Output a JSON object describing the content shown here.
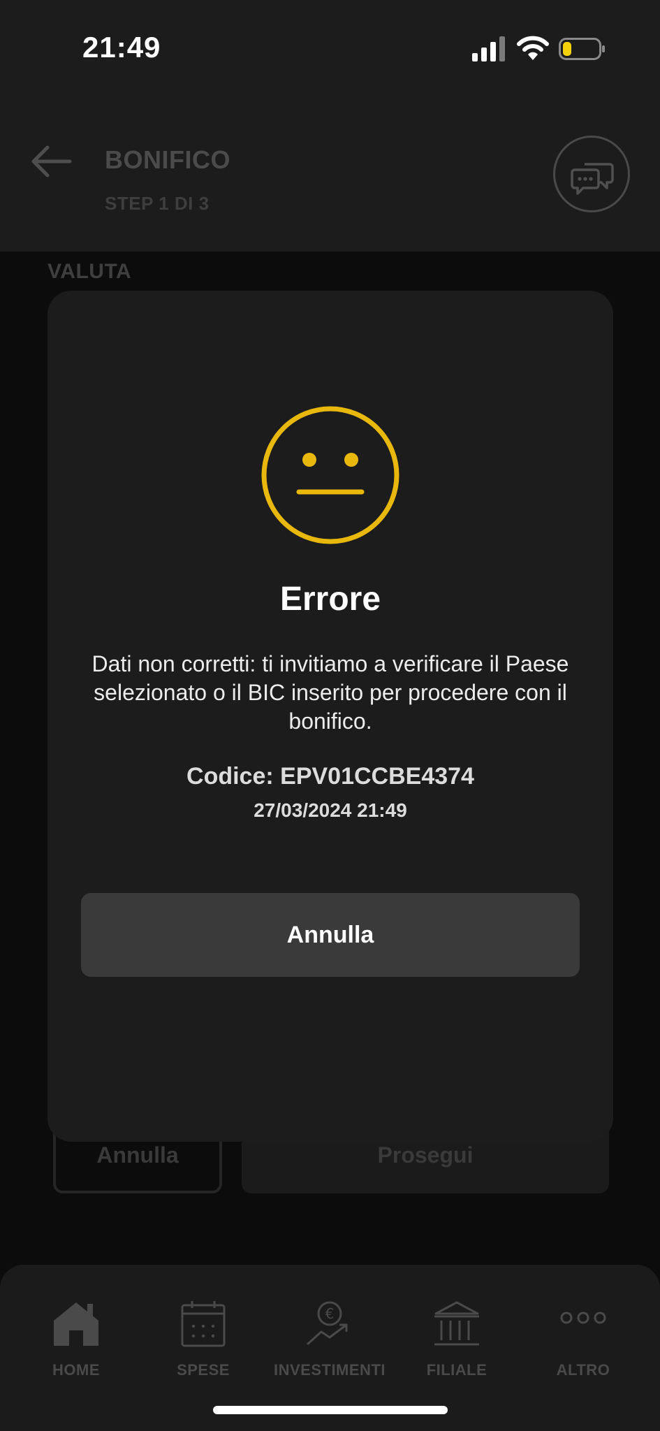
{
  "status_bar": {
    "time": "21:49"
  },
  "header": {
    "title": "BONIFICO",
    "step": "STEP 1 DI 3"
  },
  "form": {
    "section_label": "VALUTA"
  },
  "background_buttons": {
    "cancel": "Annulla",
    "next": "Prosegui"
  },
  "modal": {
    "title": "Errore",
    "message": "Dati non corretti: ti invitiamo a verificare il Paese selezionato o il BIC inserito per procedere con il bonifico.",
    "code": "Codice: EPV01CCBE4374",
    "datetime": "27/03/2024 21:49",
    "button": "Annulla",
    "accent_color": "#e8b80c"
  },
  "tabbar": {
    "items": [
      {
        "label": "HOME",
        "icon": "home-icon"
      },
      {
        "label": "SPESE",
        "icon": "calendar-icon"
      },
      {
        "label": "INVESTIMENTI",
        "icon": "investments-icon"
      },
      {
        "label": "FILIALE",
        "icon": "bank-icon"
      },
      {
        "label": "ALTRO",
        "icon": "more-icon"
      }
    ]
  }
}
